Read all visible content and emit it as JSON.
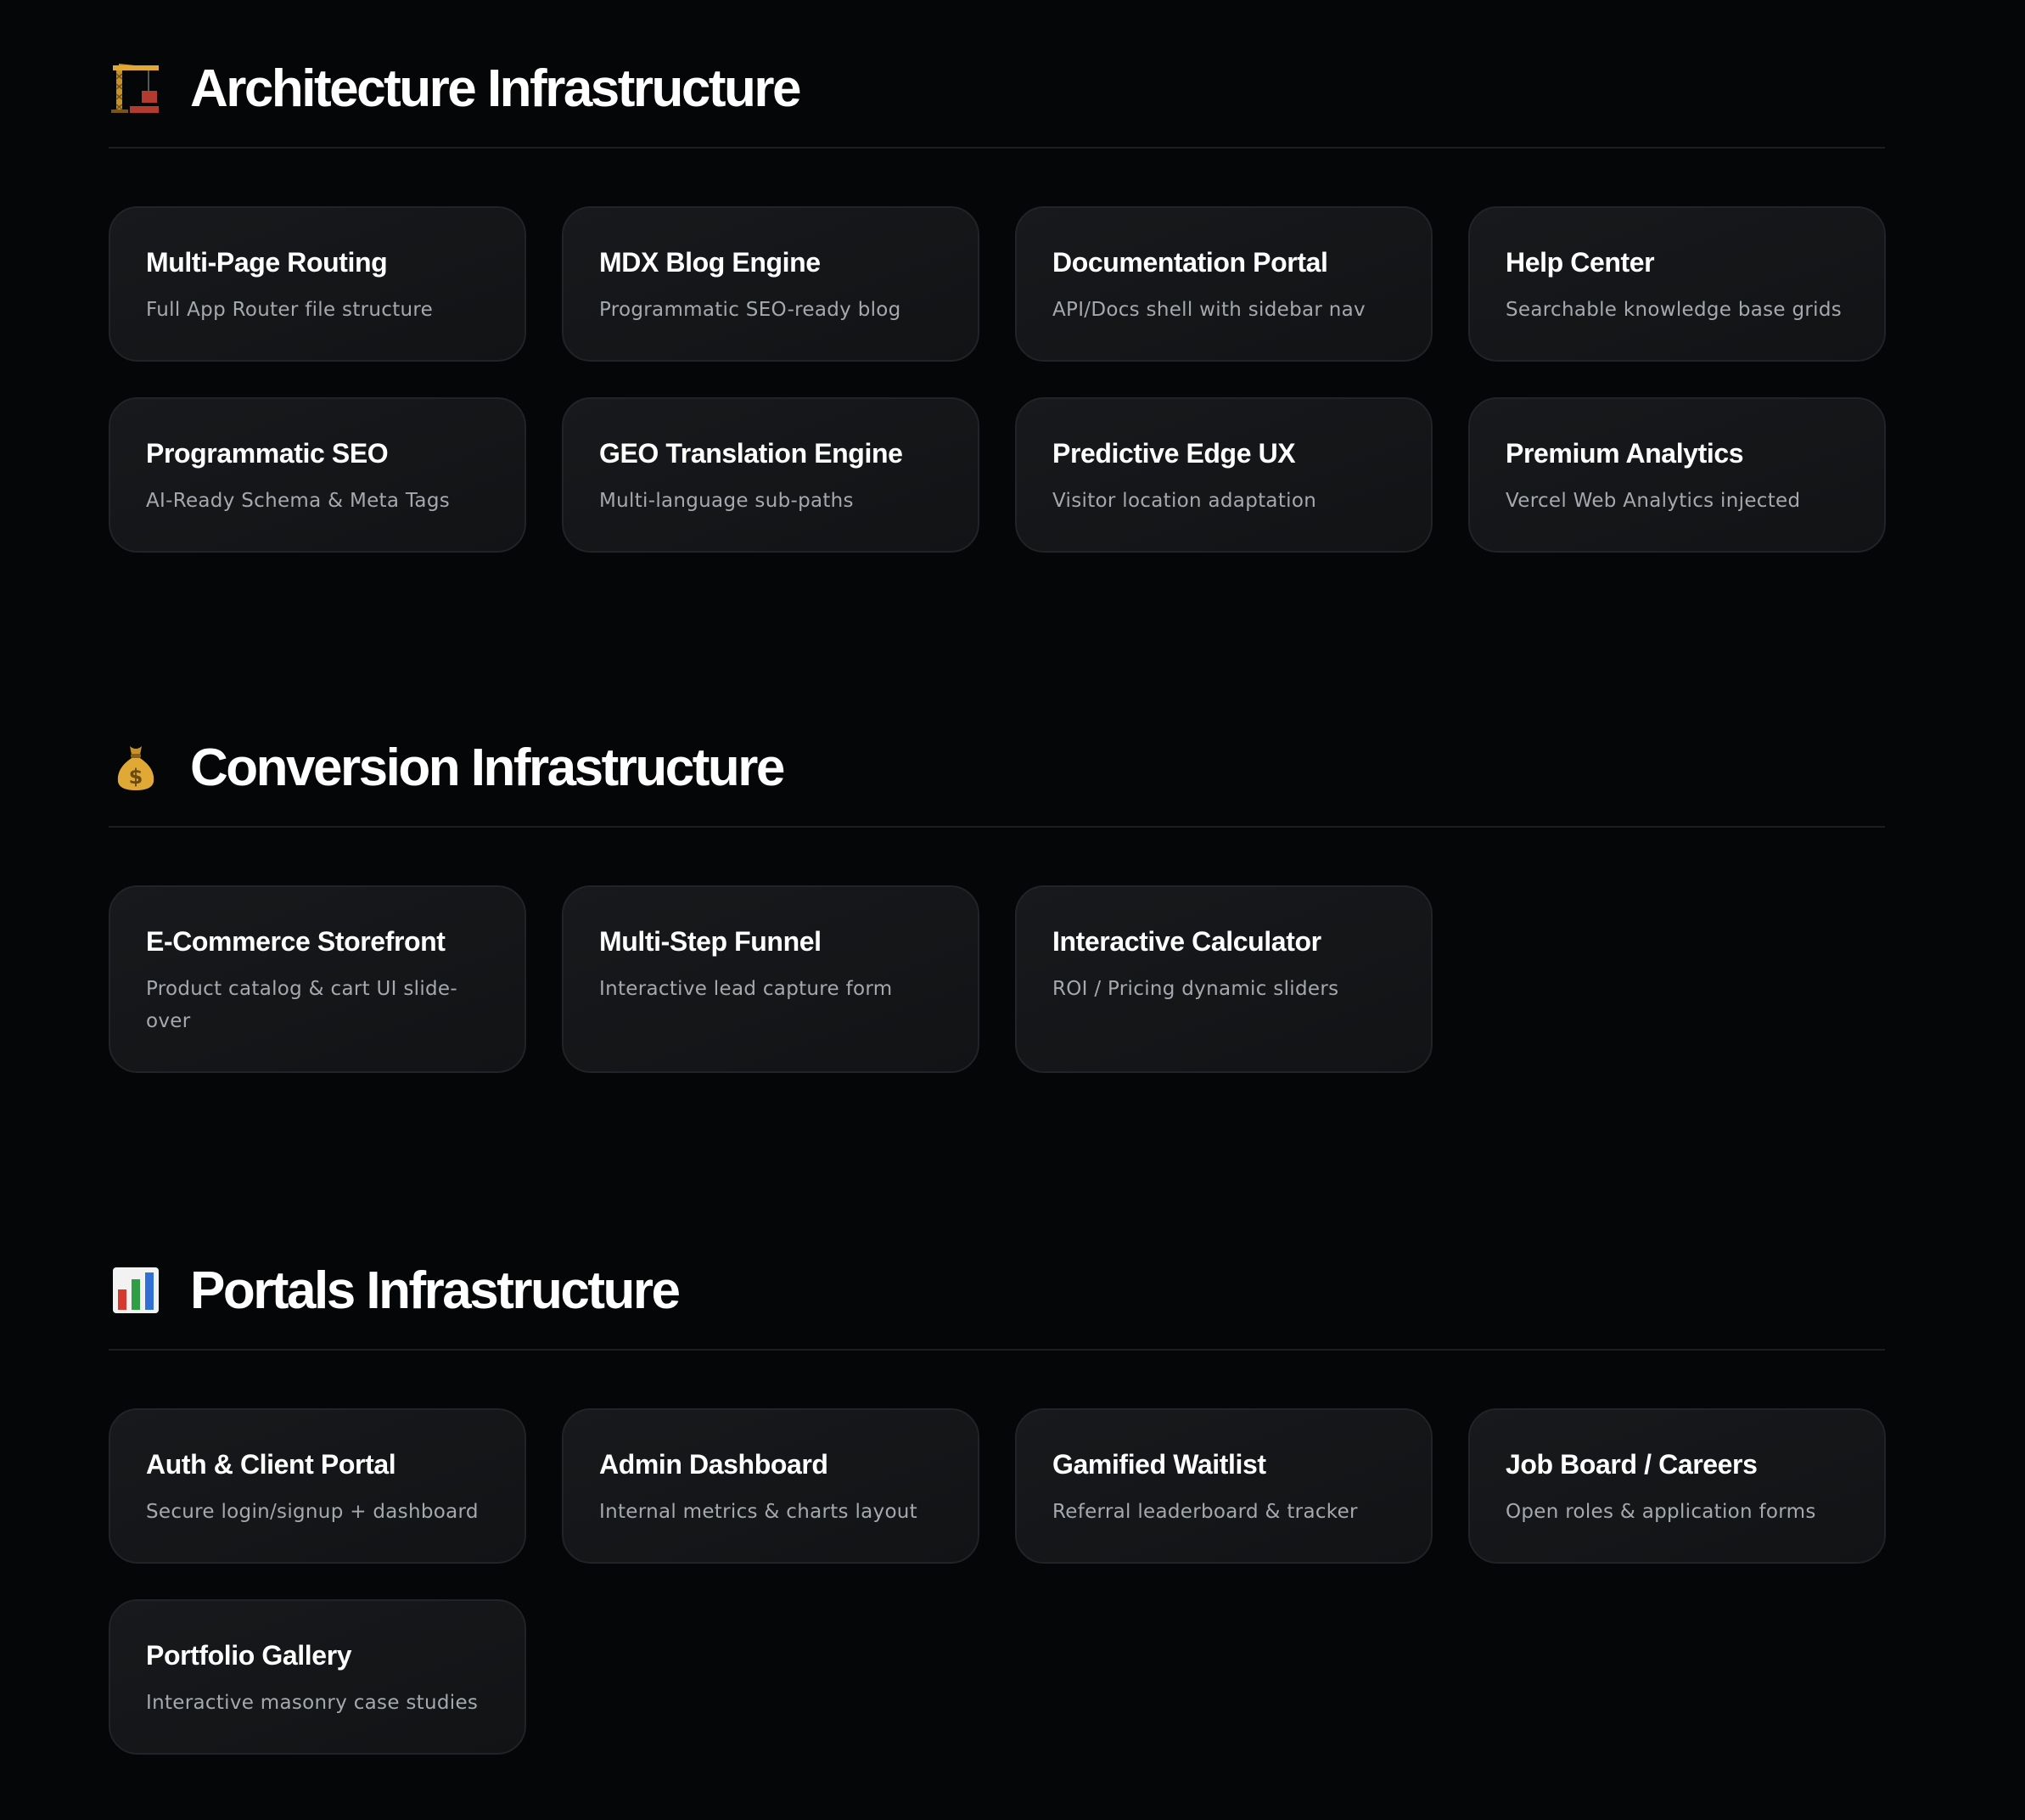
{
  "sections": [
    {
      "icon": "construction-crane-icon",
      "title": "Architecture Infrastructure",
      "cards": [
        {
          "title": "Multi-Page Routing",
          "desc": "Full App Router file structure"
        },
        {
          "title": "MDX Blog Engine",
          "desc": "Programmatic SEO-ready blog"
        },
        {
          "title": "Documentation Portal",
          "desc": "API/Docs shell with sidebar nav"
        },
        {
          "title": "Help Center",
          "desc": "Searchable knowledge base grids"
        },
        {
          "title": "Programmatic SEO",
          "desc": "AI-Ready Schema & Meta Tags"
        },
        {
          "title": "GEO Translation Engine",
          "desc": "Multi-language sub-paths"
        },
        {
          "title": "Predictive Edge UX",
          "desc": "Visitor location adaptation"
        },
        {
          "title": "Premium Analytics",
          "desc": "Vercel Web Analytics injected"
        }
      ]
    },
    {
      "icon": "money-bag-icon",
      "title": "Conversion Infrastructure",
      "cards": [
        {
          "title": "E-Commerce Storefront",
          "desc": "Product catalog & cart UI slide-over"
        },
        {
          "title": "Multi-Step Funnel",
          "desc": "Interactive lead capture form"
        },
        {
          "title": "Interactive Calculator",
          "desc": "ROI / Pricing dynamic sliders"
        }
      ]
    },
    {
      "icon": "bar-chart-icon",
      "title": "Portals Infrastructure",
      "cards": [
        {
          "title": "Auth & Client Portal",
          "desc": "Secure login/signup + dashboard"
        },
        {
          "title": "Admin Dashboard",
          "desc": "Internal metrics & charts layout"
        },
        {
          "title": "Gamified Waitlist",
          "desc": "Referral leaderboard & tracker"
        },
        {
          "title": "Job Board / Careers",
          "desc": "Open roles & application forms"
        },
        {
          "title": "Portfolio Gallery",
          "desc": "Interactive masonry case studies"
        }
      ]
    }
  ]
}
